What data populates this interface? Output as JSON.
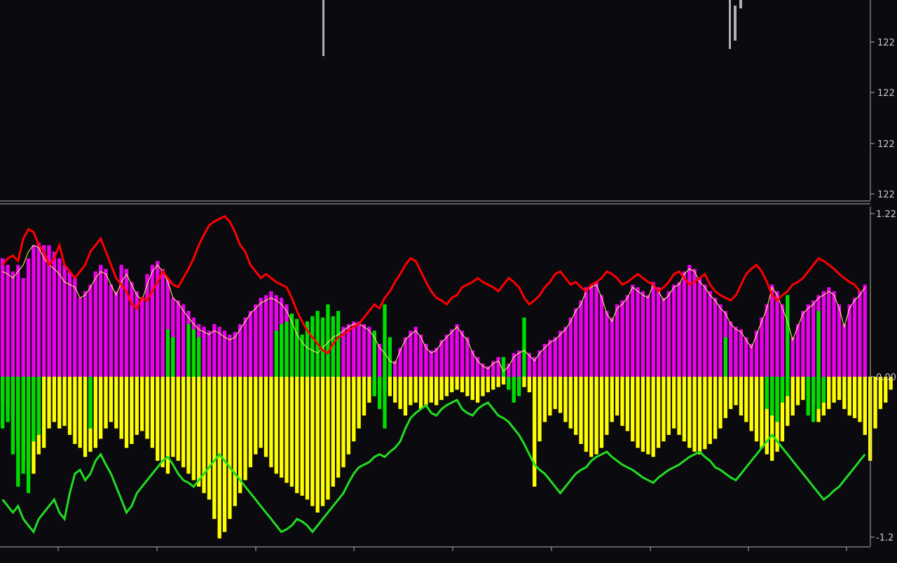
{
  "colors": {
    "background": "#0a0a0f",
    "frame": "#b4b4b4",
    "candle": "#b0b0b0",
    "axis_text": "#c8c8c8",
    "magenta": "#ee00ee",
    "yellow": "#ffff00",
    "green": "#00dd00",
    "red_line": "#ff0000",
    "green_line": "#22dd22",
    "thin_line": "#ffff66"
  },
  "price_panel": {
    "tick_labels": [
      "122",
      "122",
      "122",
      "122"
    ]
  },
  "chart_data": {
    "type": "bar",
    "ylim": [
      -1.24,
      1.24
    ],
    "y_ticks": [
      1.24,
      0.0,
      -1.24
    ],
    "y_tick_labels": [
      "1.22",
      "0.00",
      "-1.2"
    ],
    "upper_bars": [
      0.9,
      0.85,
      0.8,
      0.85,
      0.75,
      0.9,
      1.0,
      1.02,
      1.0,
      1.0,
      0.95,
      0.9,
      0.85,
      0.8,
      0.75,
      0.6,
      0.65,
      0.7,
      0.8,
      0.85,
      0.82,
      0.7,
      0.65,
      0.85,
      0.82,
      0.72,
      0.65,
      0.6,
      0.78,
      0.85,
      0.88,
      0.82,
      0.75,
      0.6,
      0.58,
      0.55,
      0.5,
      0.45,
      0.4,
      0.38,
      0.35,
      0.4,
      0.38,
      0.35,
      0.32,
      0.34,
      0.4,
      0.45,
      0.5,
      0.55,
      0.6,
      0.62,
      0.65,
      0.62,
      0.6,
      0.55,
      0.45,
      0.35,
      0.28,
      0.26,
      0.22,
      0.2,
      0.25,
      0.28,
      0.32,
      0.35,
      0.38,
      0.4,
      0.42,
      0.42,
      0.4,
      0.38,
      0.32,
      0.25,
      0.2,
      0.15,
      0.12,
      0.22,
      0.3,
      0.35,
      0.38,
      0.32,
      0.25,
      0.2,
      0.22,
      0.28,
      0.32,
      0.36,
      0.4,
      0.35,
      0.3,
      0.2,
      0.15,
      0.1,
      0.08,
      0.12,
      0.15,
      0.05,
      0.1,
      0.18,
      0.2,
      0.22,
      0.18,
      0.15,
      0.2,
      0.25,
      0.28,
      0.3,
      0.35,
      0.38,
      0.45,
      0.52,
      0.58,
      0.68,
      0.7,
      0.72,
      0.62,
      0.5,
      0.45,
      0.55,
      0.58,
      0.62,
      0.7,
      0.68,
      0.65,
      0.62,
      0.72,
      0.68,
      0.6,
      0.65,
      0.7,
      0.72,
      0.8,
      0.85,
      0.82,
      0.75,
      0.7,
      0.65,
      0.6,
      0.55,
      0.5,
      0.42,
      0.38,
      0.36,
      0.3,
      0.25,
      0.35,
      0.45,
      0.55,
      0.7,
      0.65,
      0.55,
      0.45,
      0.3,
      0.4,
      0.5,
      0.55,
      0.58,
      0.62,
      0.65,
      0.68,
      0.65,
      0.55,
      0.4,
      0.55,
      0.6,
      0.65,
      0.7
    ],
    "upper_green_bars": [
      0.0,
      0.0,
      0.0,
      0.0,
      0.0,
      0.0,
      0.0,
      0.0,
      0.0,
      0.0,
      0.0,
      0.0,
      0.0,
      0.0,
      0.0,
      0.0,
      0.0,
      0.0,
      0.0,
      0.0,
      0.0,
      0.0,
      0.0,
      0.0,
      0.0,
      0.0,
      0.0,
      0.0,
      0.0,
      0.0,
      0.0,
      0.0,
      0.36,
      0.3,
      0.0,
      0.0,
      0.4,
      0.36,
      0.3,
      0.0,
      0.0,
      0.0,
      0.0,
      0.0,
      0.0,
      0.0,
      0.0,
      0.0,
      0.0,
      0.0,
      0.0,
      0.0,
      0.0,
      0.35,
      0.4,
      0.42,
      0.48,
      0.44,
      0.32,
      0.42,
      0.46,
      0.5,
      0.45,
      0.55,
      0.46,
      0.5,
      0.0,
      0.0,
      0.0,
      0.0,
      0.0,
      0.0,
      0.35,
      0.0,
      0.55,
      0.3,
      0.0,
      0.0,
      0.0,
      0.0,
      0.0,
      0.0,
      0.0,
      0.0,
      0.0,
      0.0,
      0.0,
      0.0,
      0.0,
      0.0,
      0.0,
      0.0,
      0.0,
      0.0,
      0.0,
      0.0,
      0.0,
      0.15,
      0.0,
      0.0,
      0.0,
      0.45,
      0.0,
      0.0,
      0.0,
      0.0,
      0.0,
      0.0,
      0.0,
      0.0,
      0.0,
      0.0,
      0.0,
      0.0,
      0.0,
      0.0,
      0.0,
      0.0,
      0.0,
      0.0,
      0.0,
      0.0,
      0.0,
      0.0,
      0.0,
      0.0,
      0.0,
      0.0,
      0.0,
      0.0,
      0.0,
      0.0,
      0.0,
      0.0,
      0.0,
      0.0,
      0.0,
      0.0,
      0.0,
      0.0,
      0.3,
      0.0,
      0.0,
      0.0,
      0.0,
      0.0,
      0.0,
      0.0,
      0.0,
      0.0,
      0.0,
      0.0,
      0.62,
      0.0,
      0.0,
      0.0,
      0.0,
      0.0,
      0.5,
      0.0,
      0.0,
      0.0,
      0.0,
      0.0,
      0.0,
      0.0,
      0.0,
      0.0,
      0.0,
      0.0,
      0.0,
      0.0,
      0.0,
      0.0
    ],
    "lower_bars": [
      -0.2,
      -0.25,
      -0.3,
      -0.5,
      -0.65,
      -0.7,
      -0.75,
      -0.6,
      -0.55,
      -0.4,
      -0.35,
      -0.4,
      -0.38,
      -0.45,
      -0.52,
      -0.55,
      -0.62,
      -0.58,
      -0.55,
      -0.48,
      -0.4,
      -0.35,
      -0.4,
      -0.48,
      -0.55,
      -0.52,
      -0.45,
      -0.42,
      -0.48,
      -0.55,
      -0.65,
      -0.7,
      -0.75,
      -0.62,
      -0.65,
      -0.7,
      -0.75,
      -0.8,
      -0.85,
      -0.9,
      -0.95,
      -1.1,
      -1.25,
      -1.2,
      -1.1,
      -1.0,
      -0.9,
      -0.8,
      -0.7,
      -0.6,
      -0.55,
      -0.62,
      -0.7,
      -0.75,
      -0.78,
      -0.82,
      -0.85,
      -0.9,
      -0.92,
      -0.95,
      -1.0,
      -1.05,
      -1.0,
      -0.95,
      -0.85,
      -0.78,
      -0.7,
      -0.6,
      -0.5,
      -0.4,
      -0.3,
      -0.2,
      -0.15,
      -0.12,
      -0.1,
      -0.15,
      -0.2,
      -0.25,
      -0.3,
      -0.22,
      -0.2,
      -0.25,
      -0.22,
      -0.2,
      -0.22,
      -0.18,
      -0.15,
      -0.12,
      -0.1,
      -0.12,
      -0.15,
      -0.18,
      -0.2,
      -0.15,
      -0.12,
      -0.1,
      -0.08,
      -0.06,
      -0.1,
      -0.12,
      -0.1,
      -0.08,
      -0.12,
      -0.85,
      -0.5,
      -0.35,
      -0.3,
      -0.25,
      -0.28,
      -0.35,
      -0.4,
      -0.45,
      -0.52,
      -0.58,
      -0.62,
      -0.6,
      -0.55,
      -0.45,
      -0.35,
      -0.3,
      -0.38,
      -0.42,
      -0.5,
      -0.55,
      -0.58,
      -0.6,
      -0.62,
      -0.55,
      -0.5,
      -0.45,
      -0.4,
      -0.45,
      -0.5,
      -0.55,
      -0.58,
      -0.6,
      -0.56,
      -0.52,
      -0.48,
      -0.4,
      -0.32,
      -0.25,
      -0.22,
      -0.3,
      -0.35,
      -0.42,
      -0.5,
      -0.55,
      -0.6,
      -0.65,
      -0.58,
      -0.5,
      -0.38,
      -0.3,
      -0.22,
      -0.18,
      -0.15,
      -0.2,
      -0.35,
      -0.3,
      -0.25,
      -0.2,
      -0.18,
      -0.25,
      -0.3,
      -0.32,
      -0.35,
      -0.45,
      -0.65,
      -0.4,
      -0.25,
      -0.2,
      -0.1
    ],
    "lower_green_bars": [
      -0.4,
      -0.35,
      -0.6,
      -0.85,
      -0.75,
      -0.9,
      -0.5,
      -0.45,
      -0.0,
      -0.0,
      -0.0,
      -0.0,
      -0.0,
      -0.0,
      -0.0,
      -0.0,
      -0.0,
      -0.4,
      -0.0,
      -0.0,
      -0.0,
      -0.0,
      -0.0,
      -0.0,
      -0.0,
      -0.0,
      -0.0,
      -0.0,
      -0.0,
      -0.0,
      -0.0,
      -0.0,
      -0.0,
      -0.0,
      -0.0,
      -0.0,
      -0.0,
      -0.0,
      -0.0,
      -0.0,
      -0.0,
      -0.0,
      -0.0,
      -0.0,
      -0.0,
      -0.0,
      -0.0,
      -0.0,
      -0.0,
      -0.0,
      -0.0,
      -0.0,
      -0.0,
      -0.0,
      -0.0,
      -0.0,
      -0.0,
      -0.0,
      -0.0,
      -0.0,
      -0.0,
      -0.0,
      -0.0,
      -0.0,
      -0.0,
      -0.0,
      -0.0,
      -0.0,
      -0.0,
      -0.0,
      -0.0,
      -0.0,
      -0.15,
      -0.25,
      -0.4,
      -0.0,
      -0.0,
      -0.0,
      -0.0,
      -0.0,
      -0.0,
      -0.0,
      -0.0,
      -0.0,
      -0.0,
      -0.0,
      -0.0,
      -0.0,
      -0.0,
      -0.0,
      -0.0,
      -0.0,
      -0.0,
      -0.0,
      -0.0,
      -0.0,
      -0.0,
      -0.0,
      -0.1,
      -0.2,
      -0.15,
      -0.0,
      -0.0,
      -0.0,
      -0.0,
      -0.0,
      -0.0,
      -0.0,
      -0.0,
      -0.0,
      -0.0,
      -0.0,
      -0.0,
      -0.0,
      -0.0,
      -0.0,
      -0.0,
      -0.0,
      -0.0,
      -0.0,
      -0.0,
      -0.0,
      -0.0,
      -0.0,
      -0.0,
      -0.0,
      -0.0,
      -0.0,
      -0.0,
      -0.0,
      -0.0,
      -0.0,
      -0.0,
      -0.0,
      -0.0,
      -0.0,
      -0.0,
      -0.0,
      -0.0,
      -0.0,
      -0.0,
      -0.0,
      -0.0,
      -0.0,
      -0.0,
      -0.0,
      -0.0,
      -0.0,
      -0.25,
      -0.3,
      -0.35,
      -0.2,
      -0.15,
      -0.0,
      -0.0,
      -0.0,
      -0.3,
      -0.35,
      -0.25,
      -0.2,
      -0.0,
      -0.0,
      -0.0,
      -0.0,
      -0.0,
      -0.0,
      -0.0,
      -0.0,
      -0.0,
      -0.0,
      -0.0
    ],
    "red_line": [
      0.85,
      0.9,
      0.92,
      0.88,
      1.05,
      1.12,
      1.1,
      1.0,
      0.95,
      0.85,
      0.9,
      1.0,
      0.85,
      0.8,
      0.75,
      0.8,
      0.85,
      0.95,
      1.0,
      1.05,
      0.95,
      0.85,
      0.75,
      0.7,
      0.65,
      0.55,
      0.52,
      0.6,
      0.58,
      0.65,
      0.72,
      0.8,
      0.75,
      0.7,
      0.68,
      0.75,
      0.82,
      0.9,
      1.0,
      1.08,
      1.15,
      1.18,
      1.2,
      1.22,
      1.18,
      1.1,
      1.0,
      0.95,
      0.85,
      0.8,
      0.75,
      0.78,
      0.75,
      0.72,
      0.7,
      0.68,
      0.6,
      0.5,
      0.42,
      0.35,
      0.3,
      0.25,
      0.2,
      0.18,
      0.25,
      0.3,
      0.32,
      0.35,
      0.38,
      0.4,
      0.45,
      0.5,
      0.55,
      0.52,
      0.6,
      0.65,
      0.72,
      0.78,
      0.85,
      0.9,
      0.88,
      0.8,
      0.72,
      0.65,
      0.6,
      0.58,
      0.55,
      0.6,
      0.62,
      0.68,
      0.7,
      0.72,
      0.75,
      0.72,
      0.7,
      0.68,
      0.65,
      0.7,
      0.75,
      0.72,
      0.68,
      0.6,
      0.55,
      0.58,
      0.62,
      0.68,
      0.72,
      0.78,
      0.8,
      0.75,
      0.7,
      0.72,
      0.68,
      0.65,
      0.7,
      0.72,
      0.75,
      0.8,
      0.78,
      0.75,
      0.7,
      0.72,
      0.75,
      0.78,
      0.75,
      0.72,
      0.7,
      0.65,
      0.68,
      0.72,
      0.78,
      0.8,
      0.75,
      0.7,
      0.72,
      0.75,
      0.78,
      0.7,
      0.65,
      0.62,
      0.6,
      0.58,
      0.62,
      0.7,
      0.78,
      0.82,
      0.85,
      0.8,
      0.72,
      0.62,
      0.58,
      0.62,
      0.65,
      0.7,
      0.72,
      0.75,
      0.8,
      0.85,
      0.9,
      0.88,
      0.85,
      0.82,
      0.78,
      0.75,
      0.72,
      0.7,
      0.65
    ],
    "green_line": [
      -0.95,
      -1.0,
      -1.05,
      -1.0,
      -1.1,
      -1.15,
      -1.2,
      -1.1,
      -1.05,
      -1.0,
      -0.95,
      -1.05,
      -1.1,
      -0.9,
      -0.75,
      -0.72,
      -0.8,
      -0.75,
      -0.65,
      -0.6,
      -0.68,
      -0.75,
      -0.85,
      -0.95,
      -1.05,
      -1.0,
      -0.9,
      -0.85,
      -0.8,
      -0.75,
      -0.7,
      -0.65,
      -0.62,
      -0.68,
      -0.75,
      -0.8,
      -0.82,
      -0.85,
      -0.8,
      -0.75,
      -0.7,
      -0.65,
      -0.6,
      -0.65,
      -0.7,
      -0.75,
      -0.8,
      -0.85,
      -0.9,
      -0.95,
      -1.0,
      -1.05,
      -1.1,
      -1.15,
      -1.2,
      -1.18,
      -1.15,
      -1.1,
      -1.12,
      -1.15,
      -1.2,
      -1.15,
      -1.1,
      -1.05,
      -1.0,
      -0.95,
      -0.9,
      -0.82,
      -0.75,
      -0.7,
      -0.68,
      -0.66,
      -0.62,
      -0.6,
      -0.62,
      -0.58,
      -0.55,
      -0.5,
      -0.4,
      -0.32,
      -0.28,
      -0.25,
      -0.22,
      -0.28,
      -0.3,
      -0.25,
      -0.22,
      -0.2,
      -0.18,
      -0.25,
      -0.28,
      -0.3,
      -0.25,
      -0.22,
      -0.2,
      -0.25,
      -0.3,
      -0.32,
      -0.35,
      -0.4,
      -0.45,
      -0.52,
      -0.6,
      -0.68,
      -0.72,
      -0.75,
      -0.8,
      -0.85,
      -0.9,
      -0.85,
      -0.8,
      -0.75,
      -0.72,
      -0.7,
      -0.65,
      -0.62,
      -0.6,
      -0.58,
      -0.62,
      -0.65,
      -0.68,
      -0.7,
      -0.72,
      -0.75,
      -0.78,
      -0.8,
      -0.82,
      -0.78,
      -0.75,
      -0.72,
      -0.7,
      -0.68,
      -0.65,
      -0.62,
      -0.6,
      -0.58,
      -0.62,
      -0.65,
      -0.7,
      -0.72,
      -0.75,
      -0.78,
      -0.8,
      -0.75,
      -0.7,
      -0.65,
      -0.6,
      -0.55,
      -0.5,
      -0.45,
      -0.5,
      -0.55,
      -0.6,
      -0.65,
      -0.7,
      -0.75,
      -0.8,
      -0.85,
      -0.9,
      -0.95,
      -0.92,
      -0.88,
      -0.85,
      -0.8,
      -0.75,
      -0.7,
      -0.65,
      -0.6
    ],
    "yellow_thin_line": [
      0.8,
      0.78,
      0.75,
      0.8,
      0.85,
      0.95,
      1.0,
      0.98,
      0.9,
      0.85,
      0.82,
      0.78,
      0.72,
      0.7,
      0.68,
      0.6,
      0.62,
      0.68,
      0.75,
      0.8,
      0.78,
      0.7,
      0.62,
      0.72,
      0.78,
      0.7,
      0.62,
      0.58,
      0.7,
      0.8,
      0.85,
      0.8,
      0.72,
      0.6,
      0.56,
      0.5,
      0.45,
      0.4,
      0.36,
      0.34,
      0.32,
      0.35,
      0.33,
      0.3,
      0.28,
      0.3,
      0.36,
      0.42,
      0.48,
      0.52,
      0.56,
      0.58,
      0.6,
      0.58,
      0.55,
      0.5,
      0.42,
      0.32,
      0.26,
      0.22,
      0.2,
      0.18,
      0.22,
      0.26,
      0.3,
      0.32,
      0.35,
      0.38,
      0.4,
      0.4,
      0.38,
      0.35,
      0.3,
      0.22,
      0.18,
      0.12,
      0.1,
      0.2,
      0.28,
      0.32,
      0.35,
      0.3,
      0.22,
      0.18,
      0.2,
      0.26,
      0.3,
      0.34,
      0.38,
      0.32,
      0.28,
      0.18,
      0.12,
      0.08,
      0.06,
      0.1,
      0.12,
      0.04,
      0.08,
      0.15,
      0.18,
      0.2,
      0.16,
      0.12,
      0.18,
      0.22,
      0.26,
      0.28,
      0.32,
      0.36,
      0.42,
      0.5,
      0.55,
      0.65,
      0.68,
      0.7,
      0.6,
      0.48,
      0.42,
      0.52,
      0.55,
      0.6,
      0.68,
      0.65,
      0.62,
      0.6,
      0.7,
      0.65,
      0.58,
      0.62,
      0.68,
      0.7,
      0.78,
      0.82,
      0.8,
      0.72,
      0.68,
      0.62,
      0.58,
      0.52,
      0.48,
      0.4,
      0.36,
      0.34,
      0.28,
      0.22,
      0.32,
      0.42,
      0.52,
      0.68,
      0.62,
      0.52,
      0.42,
      0.28,
      0.38,
      0.48,
      0.52,
      0.55,
      0.6,
      0.62,
      0.65,
      0.62,
      0.52,
      0.38,
      0.52,
      0.58,
      0.62,
      0.68
    ]
  }
}
